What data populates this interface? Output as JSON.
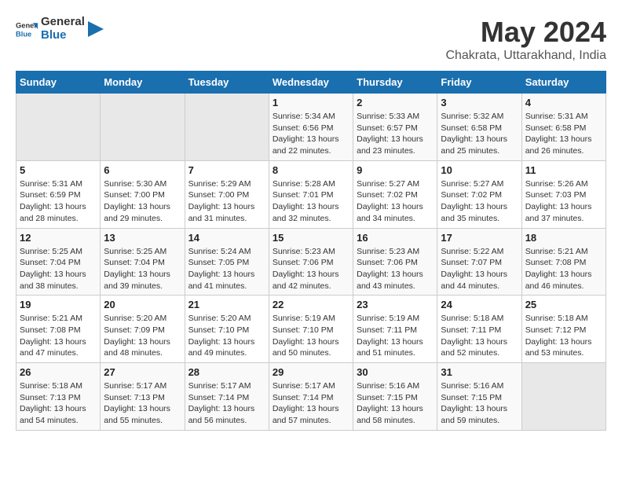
{
  "app": {
    "name_general": "General",
    "name_blue": "Blue"
  },
  "header": {
    "title": "May 2024",
    "subtitle": "Chakrata, Uttarakhand, India"
  },
  "weekdays": [
    "Sunday",
    "Monday",
    "Tuesday",
    "Wednesday",
    "Thursday",
    "Friday",
    "Saturday"
  ],
  "weeks": [
    [
      {
        "day": "",
        "empty": true
      },
      {
        "day": "",
        "empty": true
      },
      {
        "day": "",
        "empty": true
      },
      {
        "day": "1",
        "sunrise": "Sunrise: 5:34 AM",
        "sunset": "Sunset: 6:56 PM",
        "daylight": "Daylight: 13 hours and 22 minutes."
      },
      {
        "day": "2",
        "sunrise": "Sunrise: 5:33 AM",
        "sunset": "Sunset: 6:57 PM",
        "daylight": "Daylight: 13 hours and 23 minutes."
      },
      {
        "day": "3",
        "sunrise": "Sunrise: 5:32 AM",
        "sunset": "Sunset: 6:58 PM",
        "daylight": "Daylight: 13 hours and 25 minutes."
      },
      {
        "day": "4",
        "sunrise": "Sunrise: 5:31 AM",
        "sunset": "Sunset: 6:58 PM",
        "daylight": "Daylight: 13 hours and 26 minutes."
      }
    ],
    [
      {
        "day": "5",
        "sunrise": "Sunrise: 5:31 AM",
        "sunset": "Sunset: 6:59 PM",
        "daylight": "Daylight: 13 hours and 28 minutes."
      },
      {
        "day": "6",
        "sunrise": "Sunrise: 5:30 AM",
        "sunset": "Sunset: 7:00 PM",
        "daylight": "Daylight: 13 hours and 29 minutes."
      },
      {
        "day": "7",
        "sunrise": "Sunrise: 5:29 AM",
        "sunset": "Sunset: 7:00 PM",
        "daylight": "Daylight: 13 hours and 31 minutes."
      },
      {
        "day": "8",
        "sunrise": "Sunrise: 5:28 AM",
        "sunset": "Sunset: 7:01 PM",
        "daylight": "Daylight: 13 hours and 32 minutes."
      },
      {
        "day": "9",
        "sunrise": "Sunrise: 5:27 AM",
        "sunset": "Sunset: 7:02 PM",
        "daylight": "Daylight: 13 hours and 34 minutes."
      },
      {
        "day": "10",
        "sunrise": "Sunrise: 5:27 AM",
        "sunset": "Sunset: 7:02 PM",
        "daylight": "Daylight: 13 hours and 35 minutes."
      },
      {
        "day": "11",
        "sunrise": "Sunrise: 5:26 AM",
        "sunset": "Sunset: 7:03 PM",
        "daylight": "Daylight: 13 hours and 37 minutes."
      }
    ],
    [
      {
        "day": "12",
        "sunrise": "Sunrise: 5:25 AM",
        "sunset": "Sunset: 7:04 PM",
        "daylight": "Daylight: 13 hours and 38 minutes."
      },
      {
        "day": "13",
        "sunrise": "Sunrise: 5:25 AM",
        "sunset": "Sunset: 7:04 PM",
        "daylight": "Daylight: 13 hours and 39 minutes."
      },
      {
        "day": "14",
        "sunrise": "Sunrise: 5:24 AM",
        "sunset": "Sunset: 7:05 PM",
        "daylight": "Daylight: 13 hours and 41 minutes."
      },
      {
        "day": "15",
        "sunrise": "Sunrise: 5:23 AM",
        "sunset": "Sunset: 7:06 PM",
        "daylight": "Daylight: 13 hours and 42 minutes."
      },
      {
        "day": "16",
        "sunrise": "Sunrise: 5:23 AM",
        "sunset": "Sunset: 7:06 PM",
        "daylight": "Daylight: 13 hours and 43 minutes."
      },
      {
        "day": "17",
        "sunrise": "Sunrise: 5:22 AM",
        "sunset": "Sunset: 7:07 PM",
        "daylight": "Daylight: 13 hours and 44 minutes."
      },
      {
        "day": "18",
        "sunrise": "Sunrise: 5:21 AM",
        "sunset": "Sunset: 7:08 PM",
        "daylight": "Daylight: 13 hours and 46 minutes."
      }
    ],
    [
      {
        "day": "19",
        "sunrise": "Sunrise: 5:21 AM",
        "sunset": "Sunset: 7:08 PM",
        "daylight": "Daylight: 13 hours and 47 minutes."
      },
      {
        "day": "20",
        "sunrise": "Sunrise: 5:20 AM",
        "sunset": "Sunset: 7:09 PM",
        "daylight": "Daylight: 13 hours and 48 minutes."
      },
      {
        "day": "21",
        "sunrise": "Sunrise: 5:20 AM",
        "sunset": "Sunset: 7:10 PM",
        "daylight": "Daylight: 13 hours and 49 minutes."
      },
      {
        "day": "22",
        "sunrise": "Sunrise: 5:19 AM",
        "sunset": "Sunset: 7:10 PM",
        "daylight": "Daylight: 13 hours and 50 minutes."
      },
      {
        "day": "23",
        "sunrise": "Sunrise: 5:19 AM",
        "sunset": "Sunset: 7:11 PM",
        "daylight": "Daylight: 13 hours and 51 minutes."
      },
      {
        "day": "24",
        "sunrise": "Sunrise: 5:18 AM",
        "sunset": "Sunset: 7:11 PM",
        "daylight": "Daylight: 13 hours and 52 minutes."
      },
      {
        "day": "25",
        "sunrise": "Sunrise: 5:18 AM",
        "sunset": "Sunset: 7:12 PM",
        "daylight": "Daylight: 13 hours and 53 minutes."
      }
    ],
    [
      {
        "day": "26",
        "sunrise": "Sunrise: 5:18 AM",
        "sunset": "Sunset: 7:13 PM",
        "daylight": "Daylight: 13 hours and 54 minutes."
      },
      {
        "day": "27",
        "sunrise": "Sunrise: 5:17 AM",
        "sunset": "Sunset: 7:13 PM",
        "daylight": "Daylight: 13 hours and 55 minutes."
      },
      {
        "day": "28",
        "sunrise": "Sunrise: 5:17 AM",
        "sunset": "Sunset: 7:14 PM",
        "daylight": "Daylight: 13 hours and 56 minutes."
      },
      {
        "day": "29",
        "sunrise": "Sunrise: 5:17 AM",
        "sunset": "Sunset: 7:14 PM",
        "daylight": "Daylight: 13 hours and 57 minutes."
      },
      {
        "day": "30",
        "sunrise": "Sunrise: 5:16 AM",
        "sunset": "Sunset: 7:15 PM",
        "daylight": "Daylight: 13 hours and 58 minutes."
      },
      {
        "day": "31",
        "sunrise": "Sunrise: 5:16 AM",
        "sunset": "Sunset: 7:15 PM",
        "daylight": "Daylight: 13 hours and 59 minutes."
      },
      {
        "day": "",
        "empty": true
      }
    ]
  ]
}
